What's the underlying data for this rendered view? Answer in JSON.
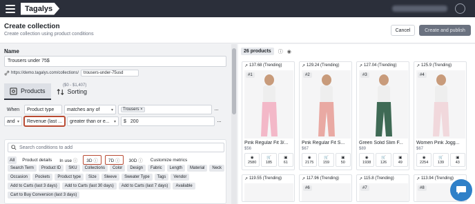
{
  "app": {
    "logo": "Tagalys"
  },
  "header": {
    "title": "Create collection",
    "subtitle": "Create collection using product conditions",
    "cancel_label": "Cancel",
    "save_label": "Create and publish"
  },
  "form": {
    "name_label": "Name",
    "name_value": "Trousers under 75$",
    "url_prefix": "https://demo.tagalys.com/collections/",
    "url_slug": "trousers-under-75usd"
  },
  "tabs": [
    {
      "label": "Products"
    },
    {
      "label": "Sorting"
    }
  ],
  "rules": [
    {
      "connector": "When",
      "field": "Product type",
      "operator": "matches any of",
      "value_chip": "Trousers ×"
    },
    {
      "connector": "and",
      "field": "Revenue (last ...",
      "operator": "greater than or e...",
      "currency": "$",
      "value": "200",
      "hint": "($0 - $1,407)"
    }
  ],
  "conditions": {
    "search_placeholder": "Search conditions to add",
    "filters": [
      "All",
      "Product details",
      "In use",
      "3D",
      "7D",
      "30D",
      "Customize metrics"
    ],
    "tags": [
      "Search Term",
      "Product ID",
      "SKU",
      "Collections",
      "Color",
      "Design",
      "Fabric",
      "Length",
      "Material",
      "Neck",
      "Occasion",
      "Pockets",
      "Product type",
      "Size",
      "Sleeve",
      "Sweater Type",
      "Tags",
      "Vendor",
      "Add to Carts (last 3 days)",
      "Add to Carts (last 30 days)",
      "Add to Carts (last 7 days)",
      "Available",
      "Cart to Buy Conversion (last 3 days)"
    ]
  },
  "products_panel": {
    "count": "26 products"
  },
  "products": [
    {
      "score": "137.68 (Trending)",
      "rank": "#1",
      "name": "Pink Regular Fit 3/...",
      "price": "$56",
      "views": "2580",
      "carts": "185",
      "buys": "61",
      "color": "#f3b8c8"
    },
    {
      "score": "129.24 (Trending)",
      "rank": "#2",
      "name": "Pink Regular Fit S...",
      "price": "$67",
      "views": "2175",
      "carts": "159",
      "buys": "50",
      "color": "#e9a9a3"
    },
    {
      "score": "127.04 (Trending)",
      "rank": "#3",
      "name": "Green Solid Slim F...",
      "price": "$89",
      "views": "1938",
      "carts": "126",
      "buys": "49",
      "color": "#3f6a55"
    },
    {
      "score": "125.9 (Trending)",
      "rank": "#4",
      "name": "Women Pink Jogg...",
      "price": "$67",
      "views": "2254",
      "carts": "139",
      "buys": "43",
      "color": "#f1d8dc"
    }
  ],
  "products_row2": [
    {
      "score": "119.55 (Trending)",
      "rank": ""
    },
    {
      "score": "117.96 (Trending)",
      "rank": "#6"
    },
    {
      "score": "115.8 (Trending)",
      "rank": "#7"
    },
    {
      "score": "113.94 (Trending)",
      "rank": "#8"
    }
  ]
}
